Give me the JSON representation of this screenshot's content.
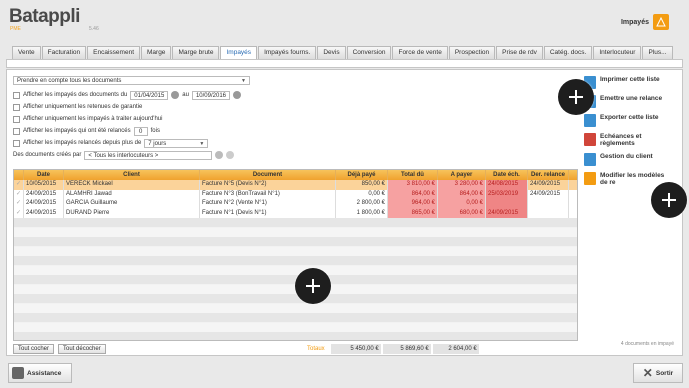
{
  "app": {
    "name": "Batappli",
    "edition": "PME",
    "version": "5.46"
  },
  "header": {
    "section_title": "Impayés"
  },
  "tabs": [
    "Vente",
    "Facturation",
    "Encaissement",
    "Marge",
    "Marge brute",
    "Impayés",
    "Impayés fourns.",
    "Devis",
    "Conversion",
    "Force de vente",
    "Prospection",
    "Prise de rdv",
    "Catég. docs.",
    "Interlocuteur",
    "Plus..."
  ],
  "active_tab_index": 5,
  "filters": {
    "doc_scope": "Prendre en compte tous les documents",
    "date_range_label": "Afficher les impayés des documents du",
    "date_from": "01/04/2015",
    "date_to_label": "au",
    "date_to": "10/09/2016",
    "retenues_label": "Afficher uniquement les retenues de garantie",
    "a_traiter_label": "Afficher uniquement les impayés à traiter aujourd'hui",
    "relances_label": "Afficher les impayés qui ont été relancés",
    "relances_count": "0",
    "relances_suffix": "fois",
    "relances_depuis_label": "Afficher les impayés relancés depuis plus de",
    "relances_depuis_value": "7 jours",
    "created_by_label": "Des documents créés par",
    "created_by_value": "< Tous les interlocuteurs >"
  },
  "table": {
    "columns": [
      "Date",
      "Client",
      "Document",
      "Déjà payé",
      "Total dû",
      "A payer",
      "Date éch.",
      "Der. relance"
    ],
    "rows": [
      {
        "date": "10/05/2015",
        "client": "VERECK Mickael",
        "document": "Facture N°5 (Devis N°2)",
        "deja_paye": "850,00 €",
        "total_du": "3 810,00 €",
        "a_payer": "3 280,00 €",
        "date_ech": "24/08/2015",
        "der_relance": "24/09/2015"
      },
      {
        "date": "24/09/2015",
        "client": "ALAMHRI Jawad",
        "document": "Facture N°3 (BonTravail N°1)",
        "deja_paye": "0,00 €",
        "total_du": "864,00 €",
        "a_payer": "864,00 €",
        "date_ech": "25/03/2019",
        "der_relance": "24/09/2015"
      },
      {
        "date": "24/09/2015",
        "client": "GARCIA Guillaume",
        "document": "Facture N°2 (Vente N°1)",
        "deja_paye": "2 800,00 €",
        "total_du": "964,00 €",
        "a_payer": "0,00 €",
        "date_ech": "",
        "der_relance": ""
      },
      {
        "date": "24/09/2015",
        "client": "DURAND Pierre",
        "document": "Facture N°1 (Devis N°1)",
        "deja_paye": "1 800,00 €",
        "total_du": "865,00 €",
        "a_payer": "680,00 €",
        "date_ech": "24/09/2015",
        "der_relance": ""
      }
    ]
  },
  "buttons": {
    "select_all": "Tout cocher",
    "deselect_all": "Tout décocher"
  },
  "totals": {
    "label": "Totaux",
    "deja_paye": "5 450,00 €",
    "total_du": "5 869,60 €",
    "a_payer": "2 604,00 €"
  },
  "side_actions": [
    {
      "label": "Imprimer cette liste",
      "color": "#3a8fd0",
      "icon": "printer-icon"
    },
    {
      "label": "Emettre une relance",
      "color": "#3a8fd0",
      "icon": "mail-icon"
    },
    {
      "label": "Exporter cette liste",
      "color": "#3a8fd0",
      "icon": "export-icon"
    },
    {
      "label": "Echéances et règlements",
      "color": "#d0453a",
      "icon": "calendar-icon"
    },
    {
      "label": "Gestion du client",
      "color": "#3a8fd0",
      "icon": "user-icon"
    },
    {
      "label": "Modifier les modèles de re",
      "color": "#f39c12",
      "icon": "edit-icon"
    }
  ],
  "doc_count": "4 documents en impayé",
  "footer": {
    "assistance": "Assistance",
    "exit": "Sortir"
  }
}
